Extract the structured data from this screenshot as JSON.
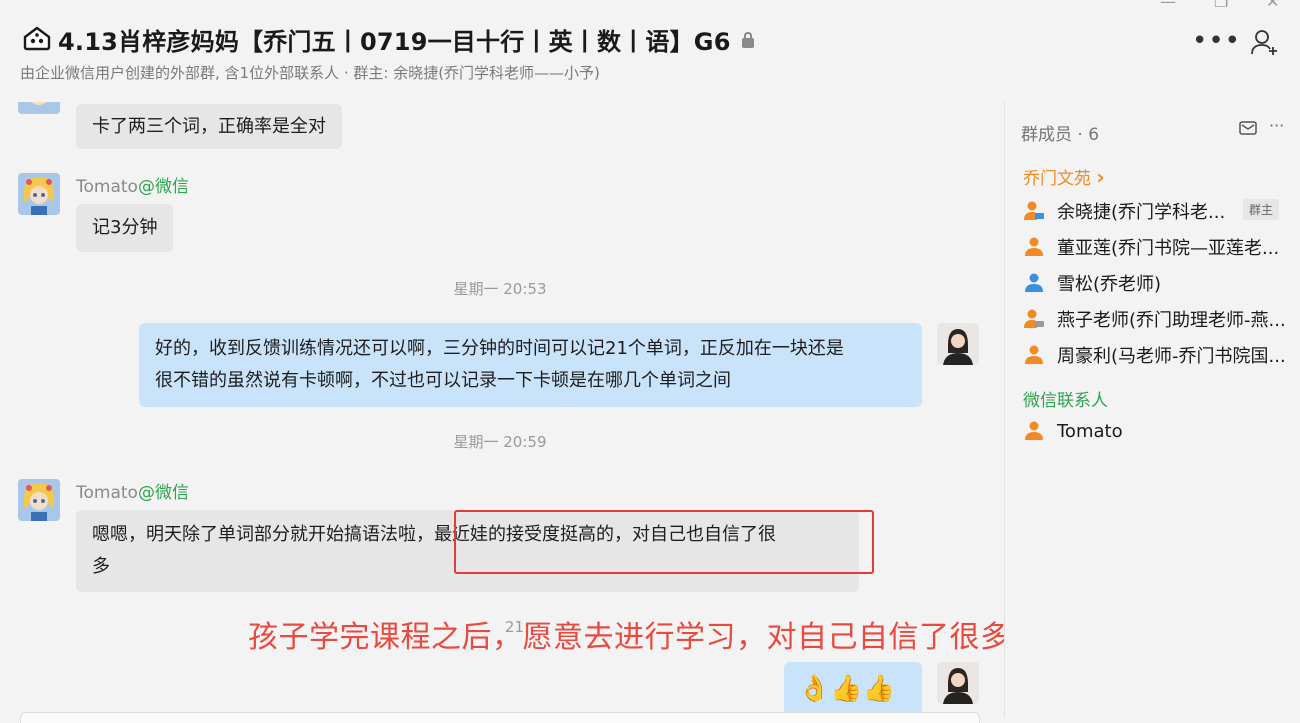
{
  "window": {
    "title": "4.13肖梓彦妈妈【乔门五丨0719一目十行丨英丨数丨语】G6",
    "subtitle": "由企业微信用户创建的外部群, 含1位外部联系人 · 群主: 余晓捷(乔门学科老师——小予)",
    "more_label": "•••"
  },
  "chat": {
    "messages": [
      {
        "text": "卡了两三个词，正确率是全对"
      },
      {
        "sender_name": "Tomato",
        "sender_tag": "@微信",
        "text": "记3分钟"
      },
      {
        "time": "星期一 20:53"
      },
      {
        "line1": "好的，收到反馈训练情况还可以啊，三分钟的时间可以记21个单词，正反加在一块还是",
        "line2": "很不错的虽然说有卡顿啊，不过也可以记录一下卡顿是在哪几个单词之间"
      },
      {
        "time": "星期一 20:59"
      },
      {
        "sender_name": "Tomato",
        "sender_tag": "@微信",
        "line1": "嗯嗯，明天除了单词部分就开始搞语法啦，最近娃的接受度挺高的，对自己也自信了很",
        "line2": "多"
      },
      {
        "time_partial": "21:"
      },
      {
        "emoji": "👌👍👍"
      }
    ],
    "annotation": "孩子学完课程之后，愿意去进行学习，对自己自信了很多"
  },
  "sidebar": {
    "title": "群成员 · 6",
    "group1_label": "乔门文苑",
    "group1_chevron": "›",
    "members": [
      {
        "name": "余晓捷(乔门学科老...",
        "badge": "群主"
      },
      {
        "name": "董亚莲(乔门书院—亚莲老..."
      },
      {
        "name": "雪松(乔老师)"
      },
      {
        "name": "燕子老师(乔门助理老师-燕..."
      },
      {
        "name": "周豪利(马老师-乔门书院国..."
      }
    ],
    "group2_label": "微信联系人",
    "group2_members": [
      {
        "name": "Tomato"
      }
    ]
  },
  "colors": {
    "accent_orange": "#f08a24",
    "wechat_green": "#2ea44f",
    "annotation_red": "#e84a3f",
    "bubble_blue": "#c9e4fa",
    "bubble_gray": "#e6e6e6"
  }
}
